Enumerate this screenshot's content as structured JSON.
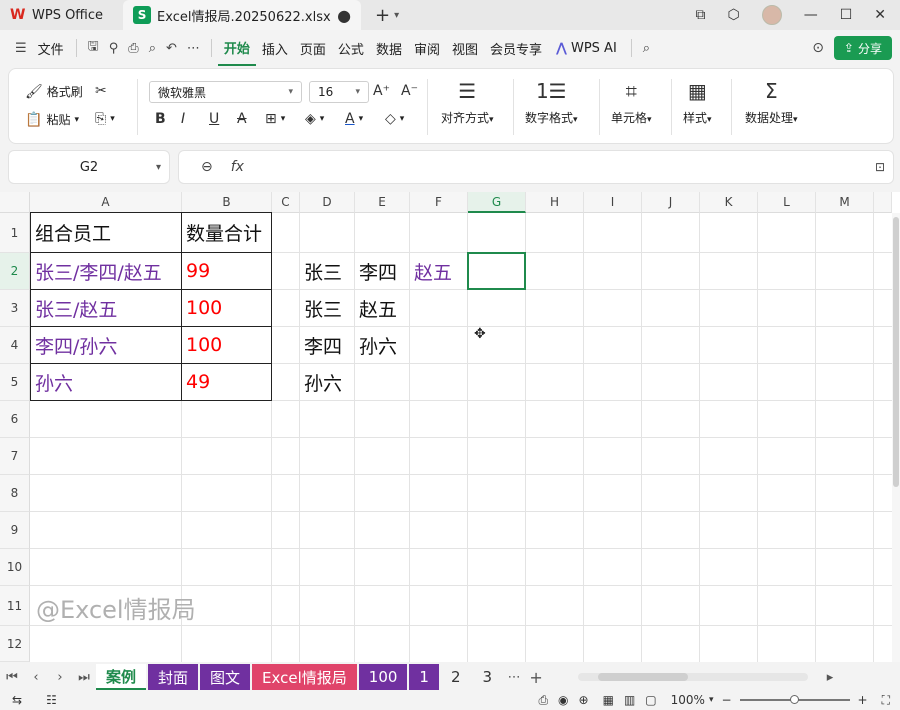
{
  "titlebar": {
    "app_name": "WPS Office",
    "doc_name": "Excel情报局.20250622.xlsx",
    "plus": "+",
    "chevron": "⌄"
  },
  "menubar": {
    "file": "文件",
    "tabs": [
      "开始",
      "插入",
      "页面",
      "公式",
      "数据",
      "审阅",
      "视图",
      "会员专享"
    ],
    "wps_ai": "WPS AI",
    "share": "分享"
  },
  "ribbon": {
    "format_painter": "格式刷",
    "paste": "粘贴",
    "font_name": "微软雅黑",
    "font_size": "16",
    "align": "对齐方式",
    "number_format": "数字格式",
    "cell": "单元格",
    "style": "样式",
    "data_process": "数据处理"
  },
  "formula_bar": {
    "name_box": "G2",
    "fx": "fx",
    "content": ""
  },
  "columns": [
    "A",
    "B",
    "C",
    "D",
    "E",
    "F",
    "G",
    "H",
    "I",
    "J",
    "K",
    "L",
    "M"
  ],
  "rows": [
    "1",
    "2",
    "3",
    "4",
    "5",
    "6",
    "7",
    "8",
    "9",
    "10",
    "11",
    "12"
  ],
  "cells": {
    "A1": "组合员工",
    "B1": "数量合计",
    "A2": "张三/李四/赵五",
    "B2": "99",
    "A3": "张三/赵五",
    "B3": "100",
    "A4": "李四/孙六",
    "B4": "100",
    "A5": "孙六",
    "B5": "49",
    "D2": "张三",
    "E2": "李四",
    "F2": "赵五",
    "D3": "张三",
    "E3": "赵五",
    "D4": "李四",
    "E4": "孙六",
    "D5": "孙六"
  },
  "watermark": "@Excel情报局",
  "sheets": [
    "案例",
    "封面",
    "图文",
    "Excel情报局",
    "100",
    "1",
    "2",
    "3"
  ],
  "colors": {
    "purple": "#7030a0",
    "red": "#ff0000",
    "accent_green": "#1f8a4c",
    "pink_tab": "#e0446a"
  },
  "status": {
    "zoom": "100%"
  }
}
